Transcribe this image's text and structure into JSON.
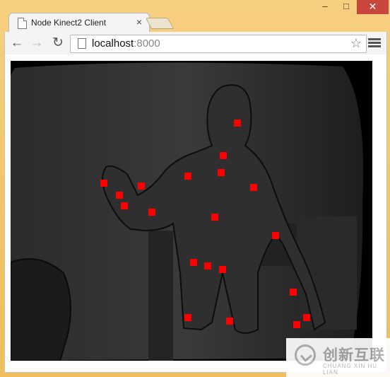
{
  "window": {
    "minimize_label": "‒",
    "maximize_label": "□",
    "close_label": "✕"
  },
  "tab": {
    "title": "Node Kinect2 Client",
    "close_label": "×",
    "icon": "page-icon"
  },
  "toolbar": {
    "back_icon": "←",
    "forward_icon": "→",
    "reload_icon": "↻",
    "url_host": "localhost",
    "url_port": ":8000",
    "bookmark_icon": "☆"
  },
  "content": {
    "joint_color": "#ff0000",
    "joint_count": 22
  },
  "watermark": {
    "title": "创新互联",
    "subtitle": "CHUANG XIN HU LIAN"
  }
}
